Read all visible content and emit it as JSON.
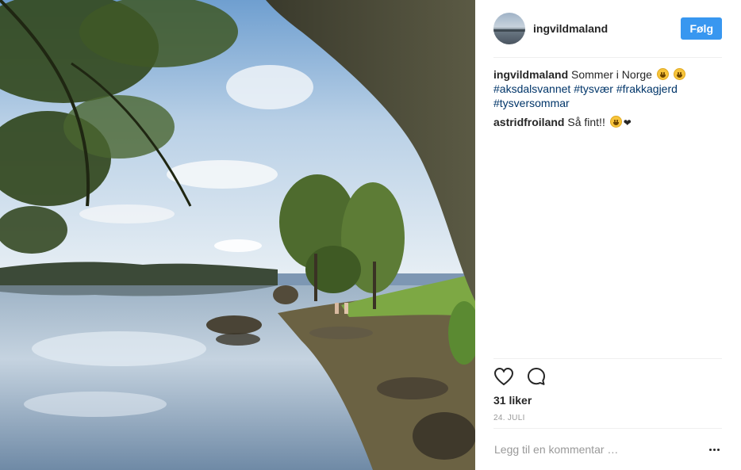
{
  "post": {
    "username": "ingvildmaland",
    "follow_label": "Følg",
    "caption": {
      "author": "ingvildmaland",
      "text": "Sommer i Norge",
      "emojis": [
        "grinning-face",
        "smiling-face"
      ],
      "hashtags": [
        "#aksdalsvannet",
        "#tysvær",
        "#frakkagjerd",
        "#tysversommar"
      ]
    },
    "comments": [
      {
        "author": "astridfroiland",
        "text": "Så fint!!",
        "emojis": [
          "grinning-face",
          "heart"
        ]
      }
    ],
    "likes": "31 liker",
    "date": "24. JULI",
    "add_comment_placeholder": "Legg til en kommentar …"
  },
  "icons": {
    "like": "heart-outline-icon",
    "comment": "speech-bubble-icon",
    "more": "ellipsis-icon"
  },
  "colors": {
    "accent": "#3897f0",
    "hashtag": "#003569",
    "muted": "#999999"
  },
  "photo": {
    "subject": "lake-with-trees-and-rock-reflection"
  }
}
